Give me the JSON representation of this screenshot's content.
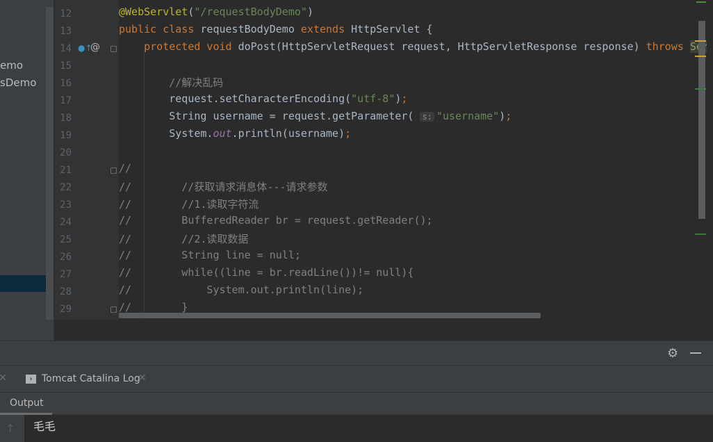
{
  "project_panel": {
    "items": [
      "emo",
      "sDemo"
    ]
  },
  "editor": {
    "line_numbers": [
      "12",
      "13",
      "14",
      "15",
      "16",
      "17",
      "18",
      "19",
      "20",
      "21",
      "22",
      "23",
      "24",
      "25",
      "26",
      "27",
      "28",
      "29"
    ],
    "lines": [
      [
        [
          "ann",
          "@WebServlet"
        ],
        [
          "",
          "("
        ],
        [
          "str",
          "\"/requestBodyDemo\""
        ],
        [
          "",
          ")"
        ]
      ],
      [
        [
          "kw",
          "public class "
        ],
        [
          "",
          "requestBodyDemo "
        ],
        [
          "kw",
          "extends "
        ],
        [
          "",
          "HttpServlet {"
        ]
      ],
      [
        [
          "",
          "    "
        ],
        [
          "kw",
          "protected void "
        ],
        [
          "",
          "doPost(HttpServletRequest request, HttpServletResponse response) "
        ],
        [
          "kw",
          "throws "
        ],
        [
          "throwsbg",
          "Ser"
        ]
      ],
      [],
      [
        [
          "cmt",
          "        //解决乱码"
        ]
      ],
      [
        [
          "",
          "        request.setCharacterEncoding("
        ],
        [
          "str",
          "\"utf-8\""
        ],
        [
          "",
          ")"
        ],
        [
          "kw",
          ";"
        ]
      ],
      [
        [
          "",
          "        String username = request.getParameter( "
        ],
        [
          "hint",
          "s:"
        ],
        [
          "str",
          "\"username\""
        ],
        [
          "",
          ")"
        ],
        [
          "kw",
          ";"
        ]
      ],
      [
        [
          "",
          "        System."
        ],
        [
          "fld",
          "out"
        ],
        [
          "",
          ".println(username)"
        ],
        [
          "kw",
          ";"
        ]
      ],
      [],
      [
        [
          "cmt",
          "//"
        ]
      ],
      [
        [
          "cmt",
          "//        //获取请求消息体---请求参数"
        ]
      ],
      [
        [
          "cmt",
          "//        //1.读取字符流"
        ]
      ],
      [
        [
          "cmt",
          "//        BufferedReader br = request.getReader();"
        ]
      ],
      [
        [
          "cmt",
          "//        //2.读取数据"
        ]
      ],
      [
        [
          "cmt",
          "//        String line = null;"
        ]
      ],
      [
        [
          "cmt",
          "//        while((line = br.readLine())!= null){"
        ]
      ],
      [
        [
          "cmt",
          "//            System.out.println(line);"
        ]
      ],
      [
        [
          "cmt",
          "//        }"
        ]
      ]
    ]
  },
  "bottom": {
    "tabs": [
      {
        "label": "Tomcat Catalina Log"
      }
    ],
    "output_tab": "Output",
    "console_output": "毛毛"
  },
  "icons": {
    "settings": "gear-icon",
    "minimize": "minimize-icon",
    "close": "close-icon",
    "scroll_up": "arrow-up-icon",
    "console": "console-icon"
  }
}
